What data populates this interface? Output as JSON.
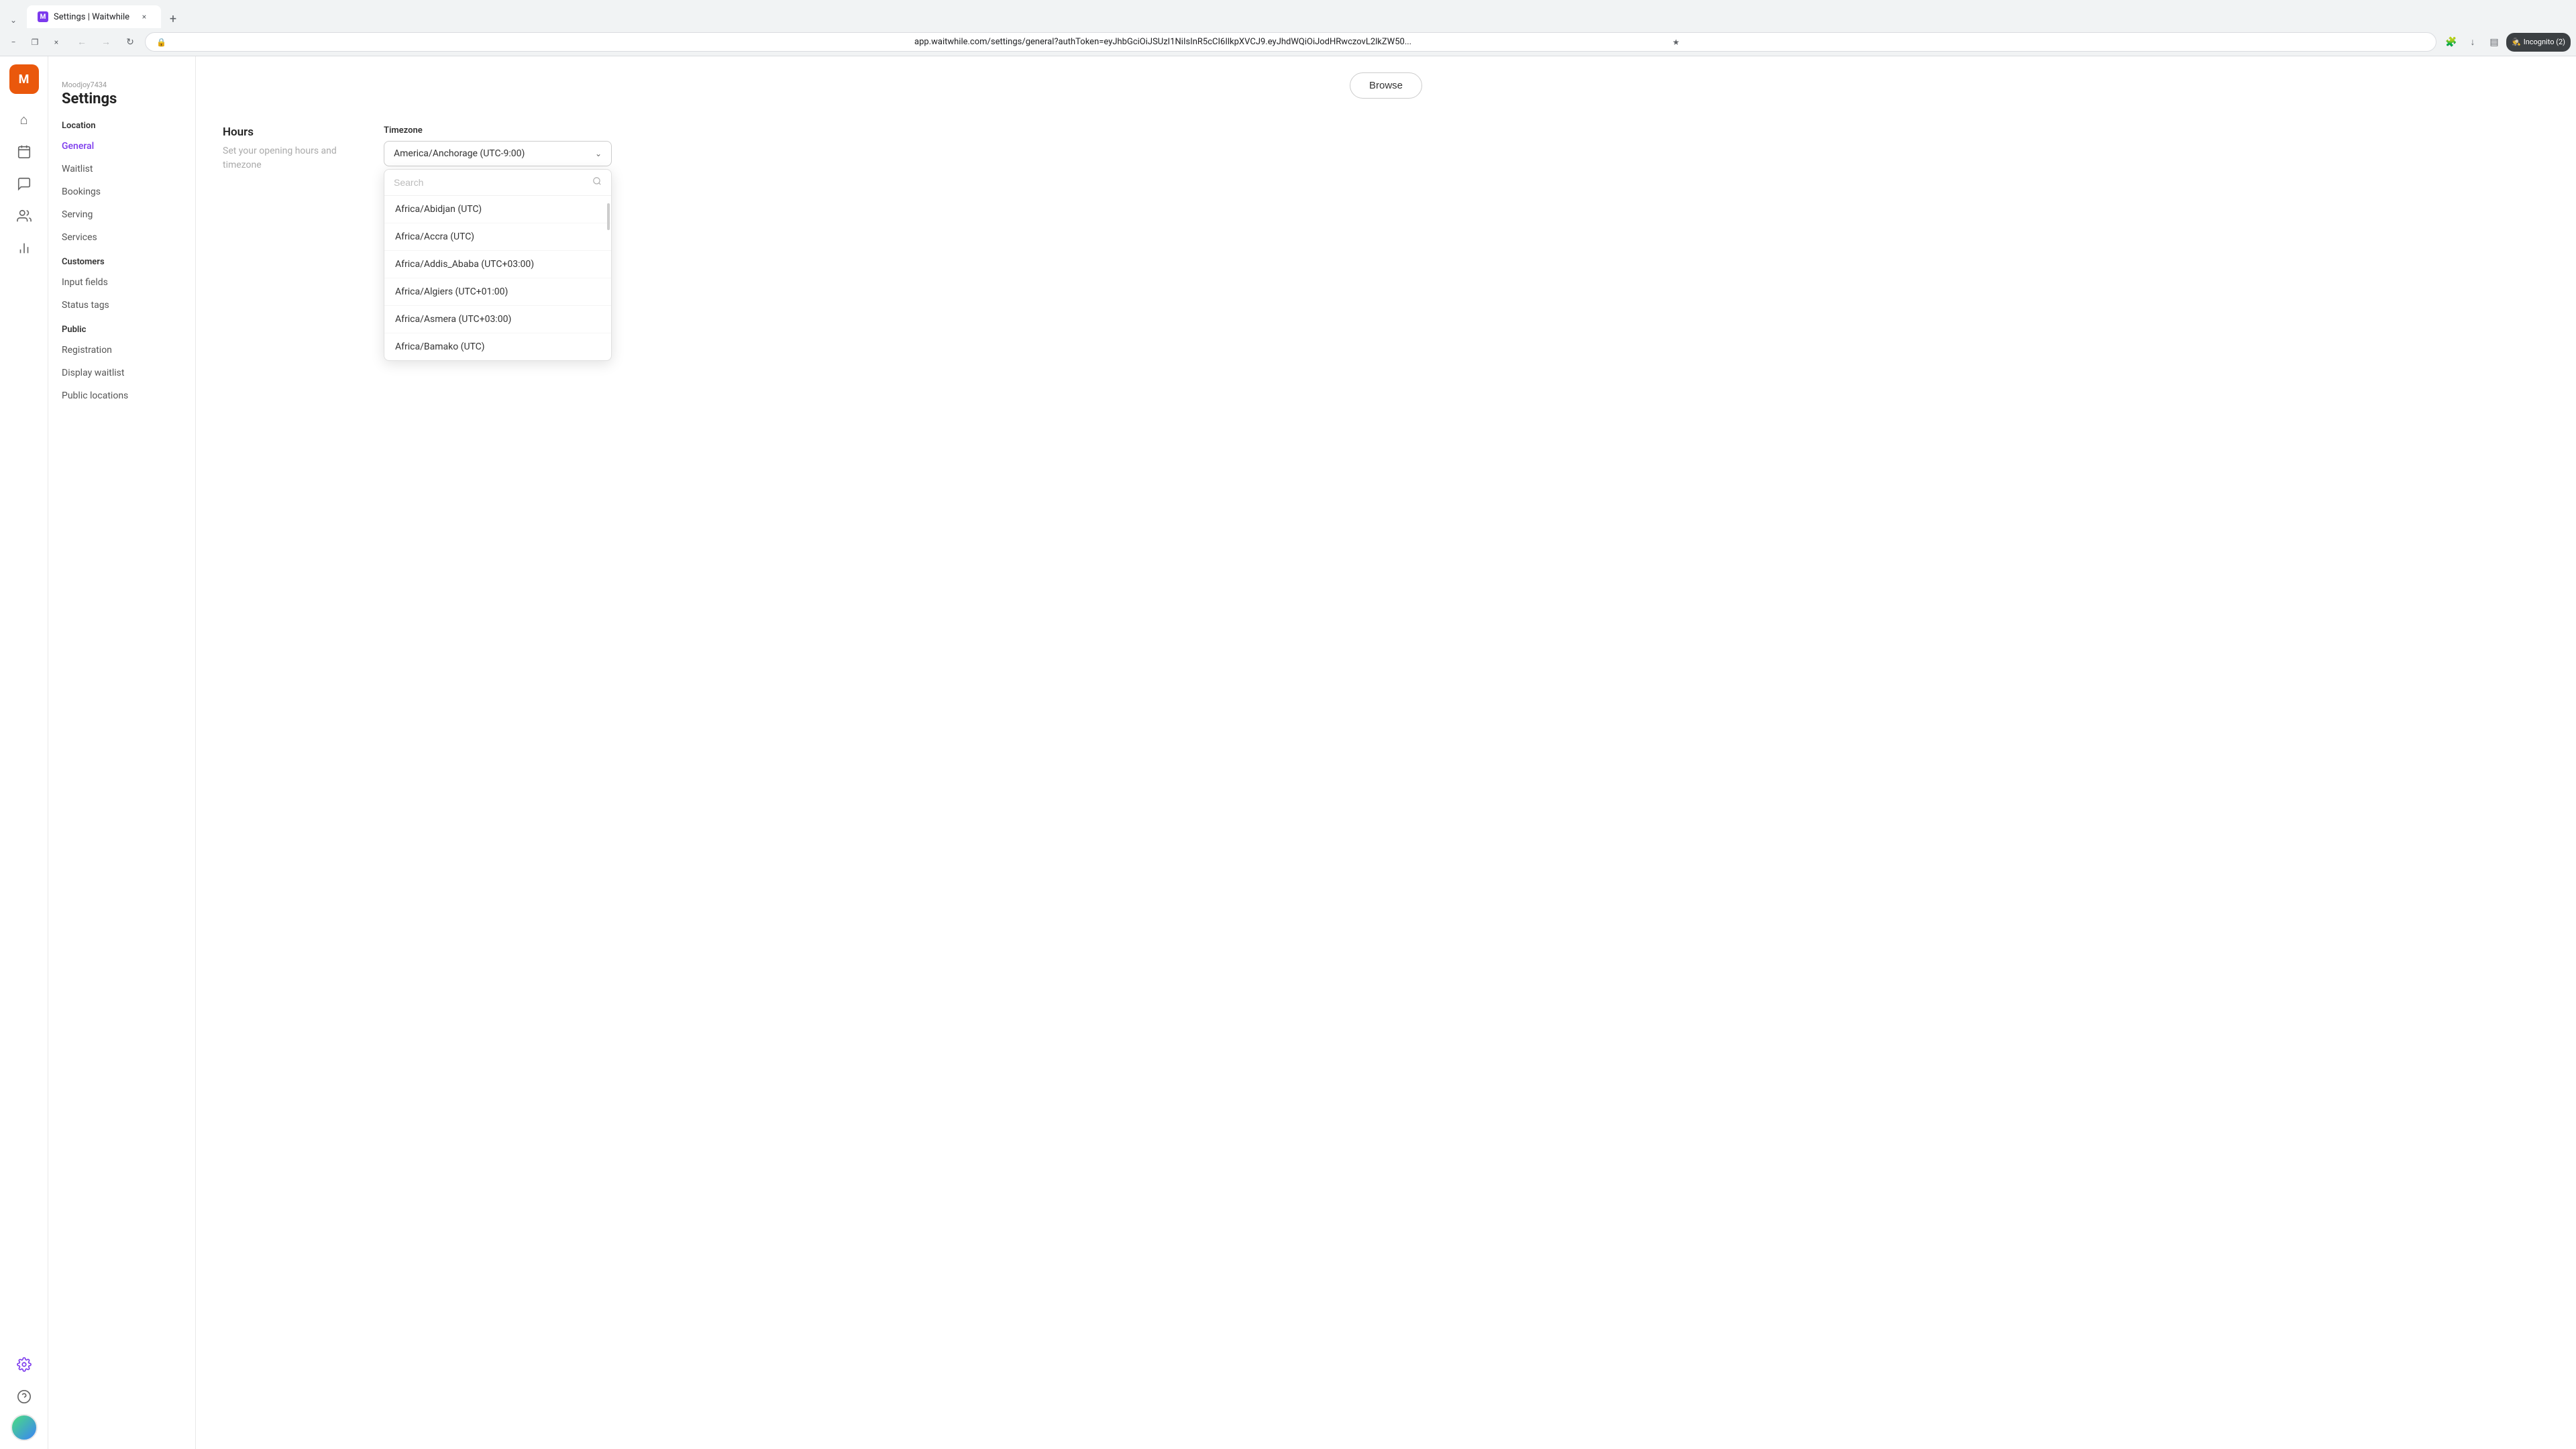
{
  "browser": {
    "tab_favicon": "M",
    "tab_title": "Settings | Waitwhile",
    "tab_close": "×",
    "tab_new": "+",
    "nav_back": "←",
    "nav_forward": "→",
    "nav_refresh": "↻",
    "address_url": "app.waitwhile.com/settings/general?authToken=eyJhbGciOiJSUzI1NiIsInR5cCI6IlkpXVCJ9.eyJhdWQiOiJodHRwczovL2lkZW50...",
    "bookmark_icon": "★",
    "download_icon": "↓",
    "profile_icon": "👤",
    "incognito_label": "Incognito (2)",
    "win_minimize": "−",
    "win_restore": "❐",
    "win_close": "×"
  },
  "sidebar": {
    "logo_letter": "M",
    "icons": [
      {
        "name": "home",
        "glyph": "⌂"
      },
      {
        "name": "calendar",
        "glyph": "▦"
      },
      {
        "name": "chat",
        "glyph": "💬"
      },
      {
        "name": "users",
        "glyph": "👥"
      },
      {
        "name": "stats",
        "glyph": "📊"
      },
      {
        "name": "settings",
        "glyph": "⚙"
      }
    ]
  },
  "settings_header": {
    "user": "Moodjoy7434",
    "title": "Settings"
  },
  "nav": {
    "location_label": "Location",
    "items": [
      {
        "label": "General",
        "active": true
      },
      {
        "label": "Waitlist",
        "active": false
      },
      {
        "label": "Bookings",
        "active": false
      },
      {
        "label": "Serving",
        "active": false
      },
      {
        "label": "Services",
        "active": false
      }
    ],
    "customers_label": "Customers",
    "customer_items": [
      {
        "label": "Input fields",
        "active": false
      },
      {
        "label": "Status tags",
        "active": false
      }
    ],
    "public_label": "Public",
    "public_items": [
      {
        "label": "Registration",
        "active": false
      },
      {
        "label": "Display waitlist",
        "active": false
      },
      {
        "label": "Public locations",
        "active": false
      }
    ]
  },
  "main": {
    "browse_label": "Browse",
    "hours_title": "Hours",
    "hours_desc": "Set your opening hours and timezone",
    "timezone_label": "Timezone",
    "timezone_selected": "America/Anchorage (UTC-9:00)",
    "search_placeholder": "Search",
    "timezone_options": [
      "Africa/Abidjan (UTC)",
      "Africa/Accra (UTC)",
      "Africa/Addis_Ababa (UTC+03:00)",
      "Africa/Algiers (UTC+01:00)",
      "Africa/Asmera (UTC+03:00)",
      "Africa/Bamako (UTC)"
    ]
  },
  "colors": {
    "accent_purple": "#7c3aed",
    "sidebar_orange": "#ea580c"
  }
}
